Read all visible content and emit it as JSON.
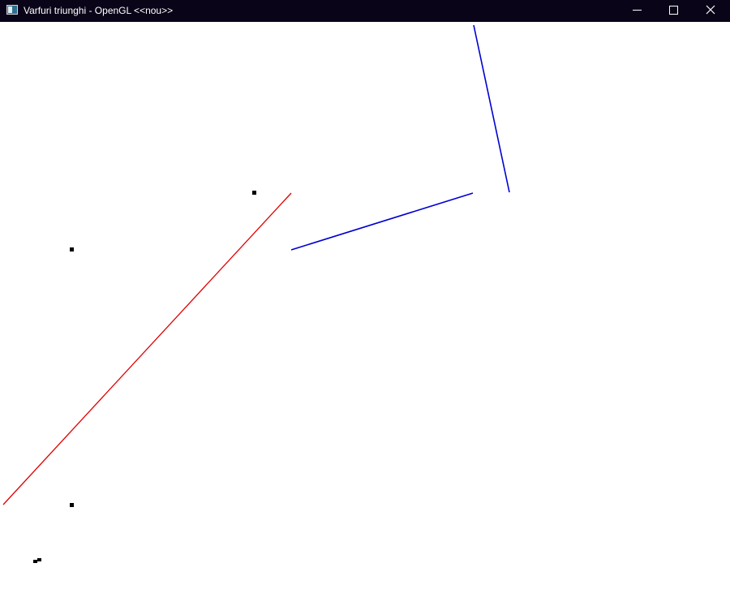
{
  "window": {
    "title": "Varfuri triunghi - OpenGL <<nou>>",
    "icon": "app-window-icon",
    "controls": {
      "minimize_icon": "minimize-icon",
      "maximize_icon": "maximize-icon",
      "close_icon": "close-icon"
    }
  },
  "canvas": {
    "background": "#ffffff",
    "colors": {
      "red_line": "#e00000",
      "blue_lines": "#0000d0",
      "points": "#000000"
    }
  }
}
